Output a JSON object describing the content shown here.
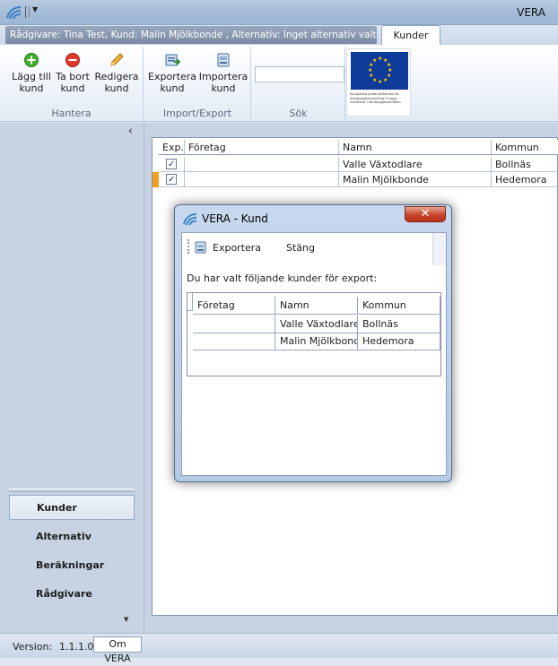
{
  "window": {
    "title": "VERA"
  },
  "context": {
    "label": "Rådgivare: Tina Test, Kund:     Malin Mjölkbonde , Alternativ: Inget alternativ valt",
    "tab_label": "Kunder"
  },
  "ribbon": {
    "groups": [
      {
        "caption": "Hantera",
        "buttons": [
          {
            "label": "Lägg till kund",
            "icon": "add-icon"
          },
          {
            "label": "Ta bort kund",
            "icon": "remove-icon"
          },
          {
            "label": "Redigera kund",
            "icon": "pencil-icon"
          }
        ]
      },
      {
        "caption": "Import/Export",
        "buttons": [
          {
            "label": "Exportera kund",
            "icon": "export-icon"
          },
          {
            "label": "Importera kund",
            "icon": "import-icon"
          }
        ]
      },
      {
        "caption": "Sök",
        "search_value": ""
      }
    ],
    "eu_text": "Europeiska jordbruksfonden för landsbygdsutveckling: Europa investerar i landsbygdsområden"
  },
  "nav": {
    "items": [
      {
        "label": "Kunder",
        "active": true
      },
      {
        "label": "Alternativ",
        "active": false
      },
      {
        "label": "Beräkningar",
        "active": false
      },
      {
        "label": "Rådgivare",
        "active": false
      }
    ]
  },
  "grid": {
    "headers": [
      "Exp.",
      "Företag",
      "Namn",
      "Kommun"
    ],
    "rows": [
      {
        "checked": true,
        "foretag": "",
        "namn": "Valle  Växtodlare",
        "kommun": "Bollnäs",
        "current": false
      },
      {
        "checked": true,
        "foretag": "",
        "namn": "Malin Mjölkbonde",
        "kommun": "Hedemora",
        "current": true
      }
    ]
  },
  "dialog": {
    "title": "VERA - Kund",
    "close_glyph": "✕",
    "toolbar": {
      "export_label": "Exportera",
      "close_label": "Stäng"
    },
    "message": "Du har valt följande kunder för export:",
    "headers": [
      "Företag",
      "Namn",
      "Kommun"
    ],
    "rows": [
      {
        "foretag": "",
        "namn": "Valle  Växtodlare",
        "kommun": "Bollnäs"
      },
      {
        "foretag": "",
        "namn": "Malin Mjölkbonde",
        "kommun": "Hedemora"
      }
    ]
  },
  "status": {
    "version_label": "Version:",
    "version_value": "1.1.1.0",
    "about_label": "Om VERA"
  },
  "colors": {
    "accent": "#4a7fc1",
    "current_row_marker": "#f0a020",
    "close_red": "#c6452b"
  }
}
